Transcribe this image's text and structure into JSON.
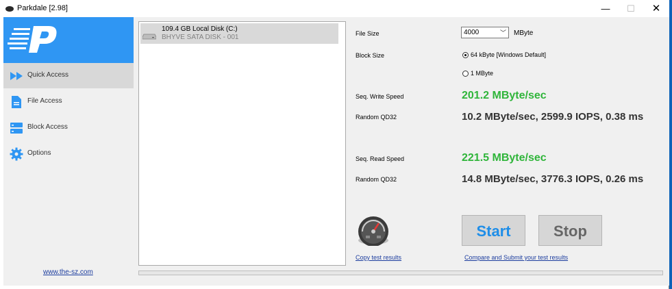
{
  "window": {
    "title": "Parkdale [2.98]",
    "minimize": "—",
    "maximize": "☐",
    "close": "✕"
  },
  "sidebar": {
    "items": [
      {
        "label": "Quick Access",
        "icon": "play-forward-icon",
        "active": true
      },
      {
        "label": "File Access",
        "icon": "document-icon",
        "active": false
      },
      {
        "label": "Block Access",
        "icon": "block-storage-icon",
        "active": false
      },
      {
        "label": "Options",
        "icon": "gear-icon",
        "active": false
      }
    ],
    "website": "www.the-sz.com"
  },
  "disks": [
    {
      "name": "109.4 GB Local Disk (C:)",
      "model": "BHYVE SATA DISK - 001"
    }
  ],
  "settings": {
    "file_size_label": "File Size",
    "file_size_value": "4000",
    "file_size_unit": "MByte",
    "block_size_label": "Block Size",
    "block_options": [
      {
        "label": "64 kByte [Windows Default]",
        "selected": true
      },
      {
        "label": "1 MByte",
        "selected": false
      }
    ]
  },
  "results": {
    "seq_write_label": "Seq. Write Speed",
    "seq_write_value": "201.2 MByte/sec",
    "rand_write_label": "Random QD32",
    "rand_write_value": "10.2 MByte/sec, 2599.9 IOPS, 0.38 ms",
    "seq_read_label": "Seq. Read Speed",
    "seq_read_value": "221.5 MByte/sec",
    "rand_read_label": "Random QD32",
    "rand_read_value": "14.8 MByte/sec, 3776.3 IOPS, 0.26 ms"
  },
  "actions": {
    "start": "Start",
    "stop": "Stop",
    "copy_results": "Copy test results",
    "compare_submit": "Compare and Submit your test results"
  },
  "progress": 0,
  "colors": {
    "accent": "#2f96f3",
    "speed_green": "#2fb53a",
    "link": "#1b3c9e"
  }
}
